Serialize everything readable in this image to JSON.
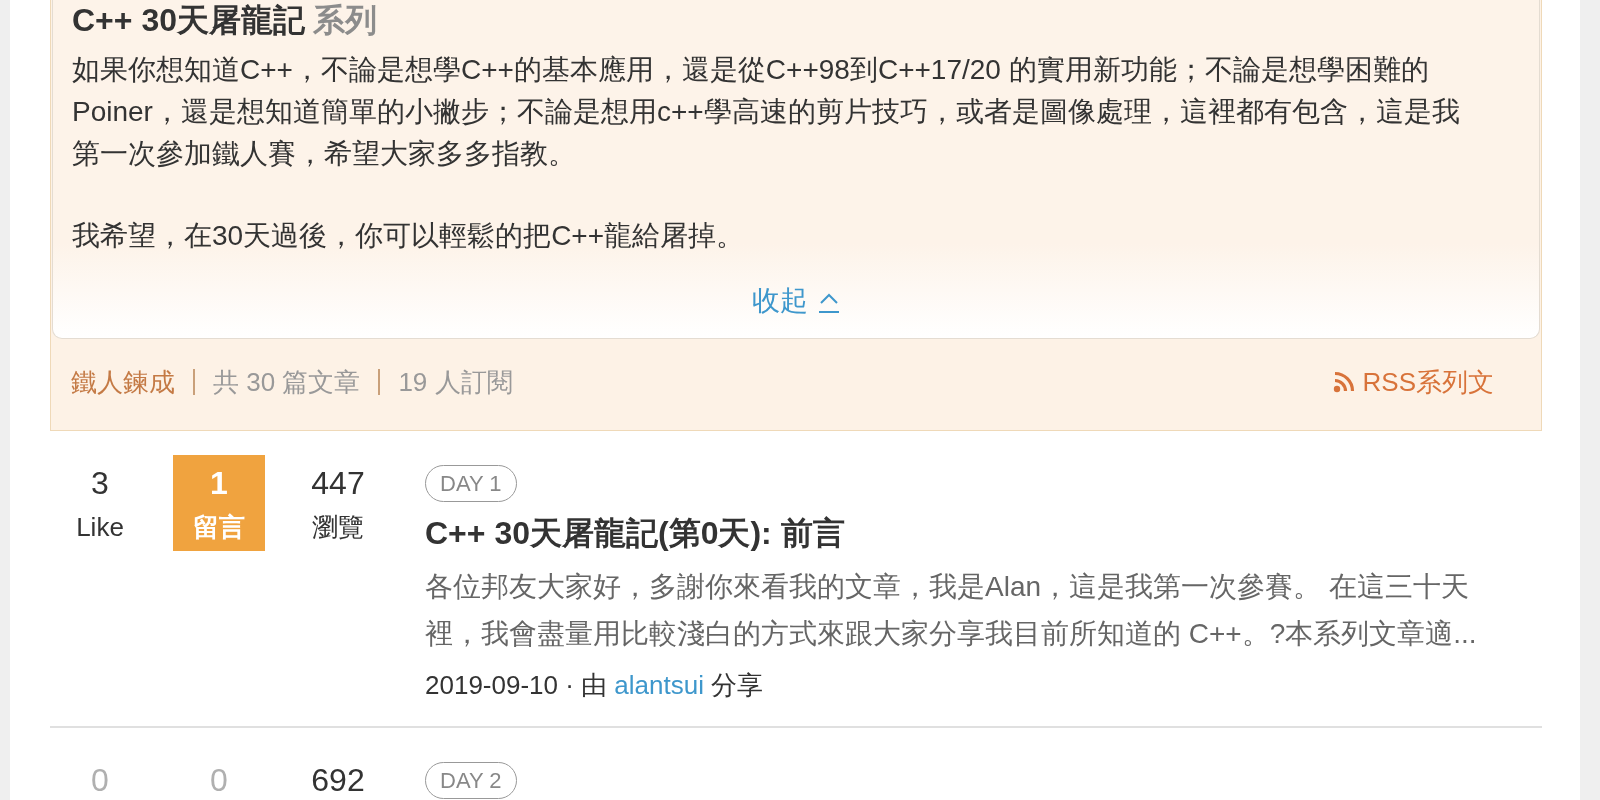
{
  "series": {
    "title": "C++ 30天屠龍記",
    "title_suffix": "系列",
    "description": [
      "如果你想知道C++，不論是想學C++的基本應用，還是從C++98到C++17/20 的實用新功能；不論是想學困難的Poiner，還是想知道簡單的小撇步；不論是想用c++學高速的剪片技巧，或者是圖像處理，這裡都有包含，這是我第一次參加鐵人賽，希望大家多多指教。",
      "我希望，在30天過後，你可以輕鬆的把C++龍給屠掉。"
    ],
    "collapse_link": "收起",
    "badge": "鐵人鍊成",
    "stats": [
      "共 30 篇文章",
      "19 人訂閱"
    ],
    "rss_link": "RSS系列文"
  },
  "articles": [
    {
      "stats": [
        {
          "kind": "like",
          "count": "3",
          "label": "Like",
          "muted": false
        },
        {
          "kind": "comment",
          "count": "1",
          "label": "留言",
          "highlighted": true,
          "muted": false
        },
        {
          "kind": "view",
          "count": "447",
          "label": "瀏覽",
          "muted": false
        }
      ],
      "day": "DAY 1",
      "title": "C++ 30天屠龍記(第0天): 前言",
      "excerpt": "各位邦友大家好，多謝你來看我的文章，我是Alan，這是我第一次參賽。 在這三十天裡，我會盡量用比較淺白的方式來跟大家分享我目前所知道的 C++。?本系列文章適...",
      "meta": {
        "date": "2019-09-10",
        "separator": "·",
        "by": "由",
        "author": "alantsui",
        "action": "分享"
      }
    },
    {
      "stats": [
        {
          "kind": "like",
          "count": "0",
          "muted": true
        },
        {
          "kind": "comment",
          "count": "0",
          "highlighted": false,
          "muted": true
        },
        {
          "kind": "view",
          "count": "692",
          "muted": false
        }
      ],
      "day": "DAY 2"
    }
  ]
}
